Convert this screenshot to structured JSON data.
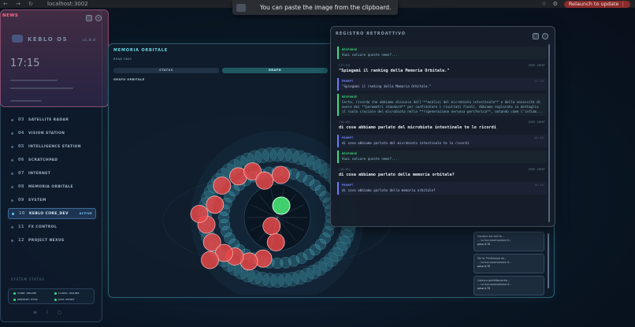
{
  "browser": {
    "nav_glyphs": "← → ↻",
    "url": "localhost:3002",
    "update_label": "Relaunch to update ⋮",
    "icons": [
      "star-icon",
      "extensions-icon",
      "profile-icon"
    ]
  },
  "toast": {
    "text": "You can paste the image from the clipboard."
  },
  "news": {
    "label": "NEWS",
    "brand": "KEBLO OS",
    "version": "v1.0.0",
    "clock": "17:15"
  },
  "sidebar": {
    "items": [
      {
        "num": "03",
        "label": "SATELLITE RADAR"
      },
      {
        "num": "04",
        "label": "VISION STATION"
      },
      {
        "num": "05",
        "label": "INTELLIGENCE STATION"
      },
      {
        "num": "06",
        "label": "SCRATCHPAD"
      },
      {
        "num": "07",
        "label": "INTERNET"
      },
      {
        "num": "08",
        "label": "MEMORIA ORBITALE"
      },
      {
        "num": "09",
        "label": "SYSTEM"
      },
      {
        "num": "10",
        "label": "KEBLO CORE_DEV",
        "badge": "ACTIVE"
      },
      {
        "num": "11",
        "label": "FX CONTROL"
      },
      {
        "num": "12",
        "label": "PROJECT NEXUS"
      }
    ],
    "system_status_label": "SYSTEM STATUS",
    "status": [
      "CORE: ONLINE",
      "LLAMA: ONLINE",
      "MEMORY: SYNC",
      "GPU: READY"
    ]
  },
  "orbit": {
    "title": "MEMORIA ORBITALE",
    "mode": "READ ONLY",
    "tabs": [
      "STATUS",
      "GRAFO",
      "NUCLEO"
    ],
    "active_tab": 1,
    "graph_label": "GRAFO ORBITALE",
    "side_cards": [
      {
        "line1": "Candice dei dati fo...",
        "line2": "... La tua osservazione è...",
        "peso": "peso 0.70"
      },
      {
        "line1": "Per la **influenza da...",
        "line2": "... La tua osservazione è...",
        "peso": "peso 0.70"
      },
      {
        "line1": "Capisco perfettamente...",
        "line2": "... La tua osservazione è...",
        "peso": "peso 0.70"
      }
    ]
  },
  "registro": {
    "title": "REGISTRO RETROATTIVO",
    "entries": [
      {
        "kind": "response",
        "label": "RESPONSE",
        "time": "",
        "text": "Vuoi salvare queste nmen?..."
      },
      {
        "kind": "user",
        "time": "[17:13]",
        "tag": "USER INPUT",
        "text": "\"Spiegami il ranking della Memoria Orbitale.\""
      },
      {
        "kind": "prompt",
        "label": "PROMPT",
        "time": "17:13",
        "text": "\"Spiegami il ranking della Memoria Orbitale.\""
      },
      {
        "kind": "response",
        "label": "RESPONSE",
        "time": "",
        "text": "Certo, ricordo che abbiamo discusso dell'**analisi del microbiota intestinale** e della necessità di avere dei **parametri standard** per confrontare i risultati finali. Abbiamo esplorato in dettaglio il ruolo cruciale del microbiota nella **rigenerazione nervosa periferica**, notando come l'infiam..."
      },
      {
        "kind": "user",
        "time": "[16:46]",
        "tag": "USER INPUT",
        "text": "di cosa abbiamo parlato del microbiota intestinale te lo ricordi"
      },
      {
        "kind": "prompt",
        "label": "PROMPT",
        "time": "16:46",
        "text": "di cosa abbiamo parlato del microbiota intestinale te lo ricordi"
      },
      {
        "kind": "response",
        "label": "RESPONSE",
        "time": "",
        "text": "Vuoi salvare queste nmen?..."
      },
      {
        "kind": "user",
        "time": "[16:45]",
        "tag": "USER INPUT",
        "text": "di cosa abbiamo parlato della memoria orbitale?"
      },
      {
        "kind": "prompt",
        "label": "PROMPT",
        "time": "16:45",
        "text": "di cosa abbiamo parlato della memoria orbitale?"
      }
    ]
  }
}
